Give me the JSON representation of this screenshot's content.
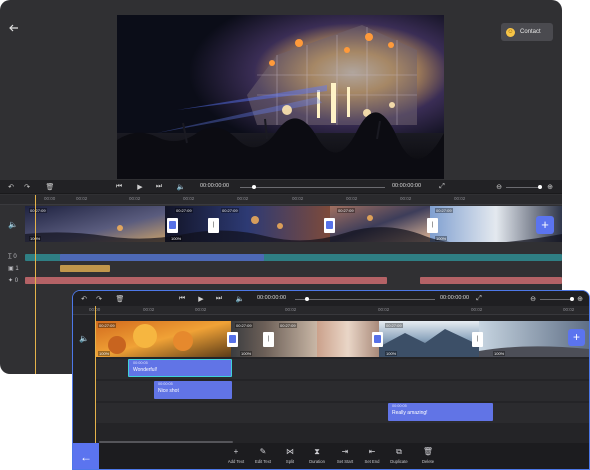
{
  "back_editor": {
    "contact_label": "Contact",
    "time_current": "00:00:00:00",
    "time_total": "00:00:00:00",
    "ruler_labels": [
      "00:00",
      "00:02",
      "00:02",
      "00:02",
      "00:02",
      "00:02",
      "00:02",
      "00:02",
      "00:02"
    ],
    "clip_durations": [
      "00:27:09",
      "00:27:09",
      "00:27:09",
      "00:27:09",
      "00:27:09"
    ],
    "volume_labels": [
      "100%",
      "100%",
      "100%"
    ],
    "track_labels": [
      "0",
      "1",
      "0"
    ],
    "colors": {
      "accent": "#5b74ef",
      "teal_track": "#2f7f84",
      "gold_track": "#c0964b",
      "rose_track": "#b46266",
      "playhead": "#e4b24a"
    }
  },
  "front_editor": {
    "time_current": "00:00:00:00",
    "time_total": "00:00:00:00",
    "ruler_labels": [
      "00:00",
      "00:02",
      "00:02",
      "00:02",
      "00:02",
      "00:02",
      "00:02"
    ],
    "clip_durations": [
      "00:27:09",
      "00:27:09",
      "00:27:09",
      "00:27:09"
    ],
    "volume_labels": [
      "100%",
      "100%",
      "100%",
      "100%"
    ],
    "text_clips": [
      {
        "time": "00:00:05",
        "name": "Wonderful!"
      },
      {
        "time": "00:00:05",
        "name": "Nice shot"
      },
      {
        "time": "00:00:05",
        "name": "Really amazing!"
      }
    ],
    "toolbar": [
      {
        "icon": "plus-icon",
        "label": "Add Text"
      },
      {
        "icon": "edit-icon",
        "label": "Edit Text"
      },
      {
        "icon": "split-icon",
        "label": "Split"
      },
      {
        "icon": "hourglass-icon",
        "label": "Duration"
      },
      {
        "icon": "set-start-icon",
        "label": "Set Start"
      },
      {
        "icon": "set-end-icon",
        "label": "Set End"
      },
      {
        "icon": "duplicate-icon",
        "label": "Duplicate"
      },
      {
        "icon": "trash-icon",
        "label": "Delete"
      }
    ]
  }
}
